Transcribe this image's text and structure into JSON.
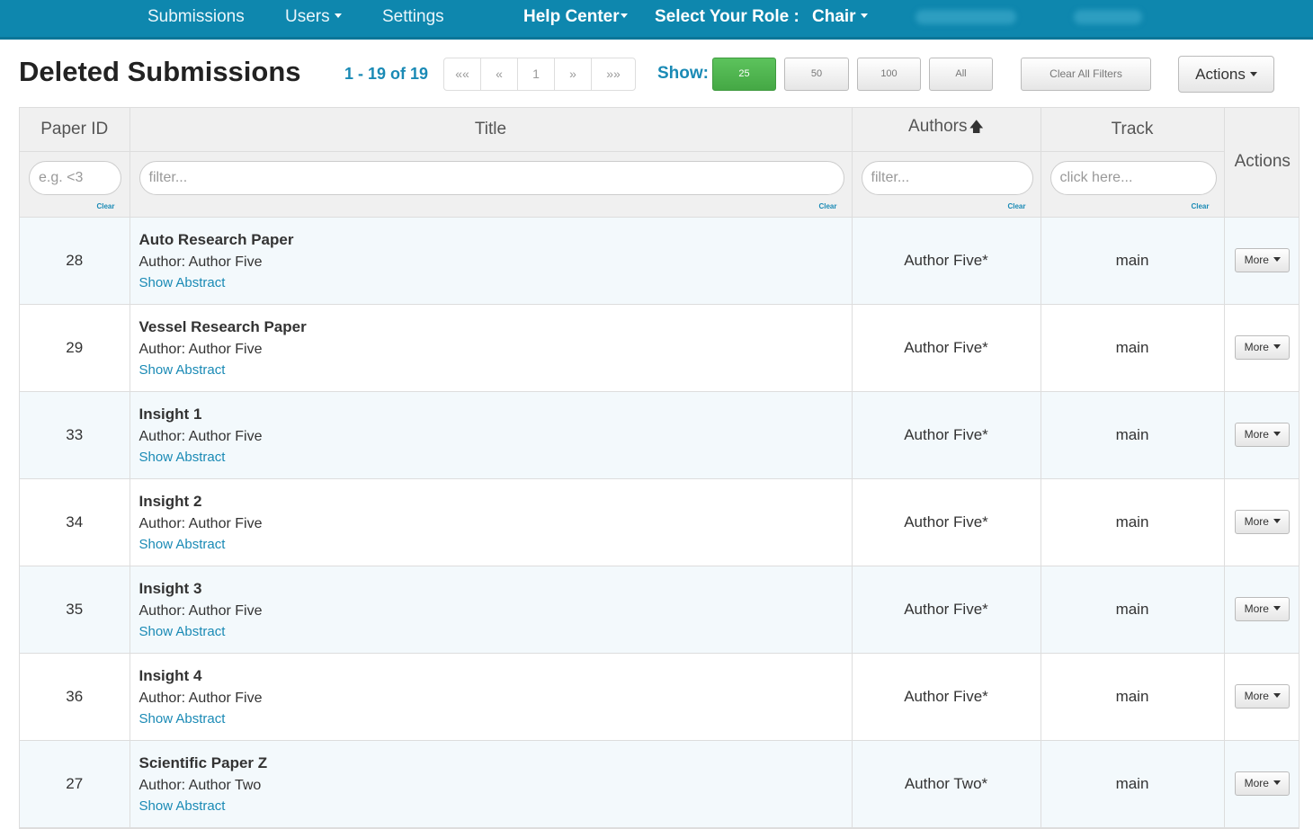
{
  "nav": {
    "submissions": "Submissions",
    "users": "Users",
    "settings": "Settings",
    "help_center": "Help Center",
    "select_role_label": "Select Your Role :",
    "role": "Chair"
  },
  "header": {
    "title": "Deleted Submissions",
    "range": "1 - 19 of 19",
    "pager": [
      "««",
      "«",
      "1",
      "»",
      "»»"
    ],
    "show_label": "Show:",
    "show_options": [
      "25",
      "50",
      "100",
      "All"
    ],
    "show_selected": "25",
    "clear_filters": "Clear All Filters",
    "actions": "Actions"
  },
  "table": {
    "columns": [
      "Paper ID",
      "Title",
      "Authors",
      "Track",
      "Actions"
    ],
    "sorted_column": "Authors",
    "filters": {
      "paper_id_placeholder": "e.g. <3",
      "title_placeholder": "filter...",
      "authors_placeholder": "filter...",
      "track_placeholder": "click here...",
      "clear_label": "Clear"
    },
    "author_prefix": "Author:",
    "show_abstract": "Show Abstract",
    "more_label": "More",
    "rows": [
      {
        "id": "28",
        "title": "Auto Research Paper",
        "author": "Author Five",
        "authors": "Author Five*",
        "track": "main"
      },
      {
        "id": "29",
        "title": "Vessel Research Paper",
        "author": "Author Five",
        "authors": "Author Five*",
        "track": "main"
      },
      {
        "id": "33",
        "title": "Insight 1",
        "author": "Author Five",
        "authors": "Author Five*",
        "track": "main"
      },
      {
        "id": "34",
        "title": "Insight 2",
        "author": "Author Five",
        "authors": "Author Five*",
        "track": "main"
      },
      {
        "id": "35",
        "title": "Insight 3",
        "author": "Author Five",
        "authors": "Author Five*",
        "track": "main"
      },
      {
        "id": "36",
        "title": "Insight 4",
        "author": "Author Five",
        "authors": "Author Five*",
        "track": "main"
      },
      {
        "id": "27",
        "title": "Scientific Paper Z",
        "author": "Author Two",
        "authors": "Author Two*",
        "track": "main"
      }
    ]
  },
  "colors": {
    "nav_bg": "#0e87ae",
    "accent": "#1a8ab5",
    "active_green": "#45a845"
  }
}
